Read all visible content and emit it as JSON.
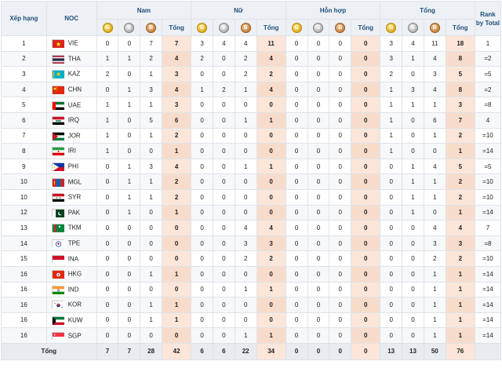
{
  "headers": {
    "xep_hang": "Xếp hạng",
    "noc": "NOC",
    "groups": [
      "Nam",
      "Nữ",
      "Hỗn hợp",
      "Tổng"
    ],
    "rank_by_total_line1": "Rank",
    "rank_by_total_line2": "by",
    "rank_by_total_line3": "Total",
    "tong": "Tổng",
    "medal_letters": {
      "gold": "G",
      "silver": "S",
      "bronze": "B"
    }
  },
  "colors": {
    "header_bg": "#edf1f5",
    "total_col_bg": "#fbe6d9",
    "header_text": "#1f4e79"
  },
  "rows": [
    {
      "rank": "1",
      "code": "VIE",
      "flag": "flag-vietnam",
      "nam": [
        "0",
        "0",
        "7",
        "7"
      ],
      "nu": [
        "3",
        "4",
        "4",
        "11"
      ],
      "hh": [
        "0",
        "0",
        "0",
        "0"
      ],
      "tong": [
        "3",
        "4",
        "11",
        "18"
      ],
      "rbt": "1"
    },
    {
      "rank": "2",
      "code": "THA",
      "flag": "flag-thailand",
      "nam": [
        "1",
        "1",
        "2",
        "4"
      ],
      "nu": [
        "2",
        "0",
        "2",
        "4"
      ],
      "hh": [
        "0",
        "0",
        "0",
        "0"
      ],
      "tong": [
        "3",
        "1",
        "4",
        "8"
      ],
      "rbt": "=2"
    },
    {
      "rank": "3",
      "code": "KAZ",
      "flag": "flag-kazakhstan",
      "nam": [
        "2",
        "0",
        "1",
        "3"
      ],
      "nu": [
        "0",
        "0",
        "2",
        "2"
      ],
      "hh": [
        "0",
        "0",
        "0",
        "0"
      ],
      "tong": [
        "2",
        "0",
        "3",
        "5"
      ],
      "rbt": "=5"
    },
    {
      "rank": "4",
      "code": "CHN",
      "flag": "flag-china",
      "nam": [
        "0",
        "1",
        "3",
        "4"
      ],
      "nu": [
        "1",
        "2",
        "1",
        "4"
      ],
      "hh": [
        "0",
        "0",
        "0",
        "0"
      ],
      "tong": [
        "1",
        "3",
        "4",
        "8"
      ],
      "rbt": "=2"
    },
    {
      "rank": "5",
      "code": "UAE",
      "flag": "flag-uae",
      "nam": [
        "1",
        "1",
        "1",
        "3"
      ],
      "nu": [
        "0",
        "0",
        "0",
        "0"
      ],
      "hh": [
        "0",
        "0",
        "0",
        "0"
      ],
      "tong": [
        "1",
        "1",
        "1",
        "3"
      ],
      "rbt": "=8"
    },
    {
      "rank": "6",
      "code": "IRQ",
      "flag": "flag-iraq",
      "nam": [
        "1",
        "0",
        "5",
        "6"
      ],
      "nu": [
        "0",
        "0",
        "1",
        "1"
      ],
      "hh": [
        "0",
        "0",
        "0",
        "0"
      ],
      "tong": [
        "1",
        "0",
        "6",
        "7"
      ],
      "rbt": "4"
    },
    {
      "rank": "7",
      "code": "JOR",
      "flag": "flag-jordan",
      "nam": [
        "1",
        "0",
        "1",
        "2"
      ],
      "nu": [
        "0",
        "0",
        "0",
        "0"
      ],
      "hh": [
        "0",
        "0",
        "0",
        "0"
      ],
      "tong": [
        "1",
        "0",
        "1",
        "2"
      ],
      "rbt": "=10"
    },
    {
      "rank": "8",
      "code": "IRI",
      "flag": "flag-iran",
      "nam": [
        "1",
        "0",
        "0",
        "1"
      ],
      "nu": [
        "0",
        "0",
        "0",
        "0"
      ],
      "hh": [
        "0",
        "0",
        "0",
        "0"
      ],
      "tong": [
        "1",
        "0",
        "0",
        "1"
      ],
      "rbt": "=14"
    },
    {
      "rank": "9",
      "code": "PHI",
      "flag": "flag-philippines",
      "nam": [
        "0",
        "1",
        "3",
        "4"
      ],
      "nu": [
        "0",
        "0",
        "1",
        "1"
      ],
      "hh": [
        "0",
        "0",
        "0",
        "0"
      ],
      "tong": [
        "0",
        "1",
        "4",
        "5"
      ],
      "rbt": "=5"
    },
    {
      "rank": "10",
      "code": "MGL",
      "flag": "flag-mongolia",
      "nam": [
        "0",
        "1",
        "1",
        "2"
      ],
      "nu": [
        "0",
        "0",
        "0",
        "0"
      ],
      "hh": [
        "0",
        "0",
        "0",
        "0"
      ],
      "tong": [
        "0",
        "1",
        "1",
        "2"
      ],
      "rbt": "=10"
    },
    {
      "rank": "10",
      "code": "SYR",
      "flag": "flag-syria",
      "nam": [
        "0",
        "1",
        "1",
        "2"
      ],
      "nu": [
        "0",
        "0",
        "0",
        "0"
      ],
      "hh": [
        "0",
        "0",
        "0",
        "0"
      ],
      "tong": [
        "0",
        "1",
        "1",
        "2"
      ],
      "rbt": "=10"
    },
    {
      "rank": "12",
      "code": "PAK",
      "flag": "flag-pakistan",
      "nam": [
        "0",
        "1",
        "0",
        "1"
      ],
      "nu": [
        "0",
        "0",
        "0",
        "0"
      ],
      "hh": [
        "0",
        "0",
        "0",
        "0"
      ],
      "tong": [
        "0",
        "1",
        "0",
        "1"
      ],
      "rbt": "=14"
    },
    {
      "rank": "13",
      "code": "TKM",
      "flag": "flag-turkmenistan",
      "nam": [
        "0",
        "0",
        "0",
        "0"
      ],
      "nu": [
        "0",
        "0",
        "4",
        "4"
      ],
      "hh": [
        "0",
        "0",
        "0",
        "0"
      ],
      "tong": [
        "0",
        "0",
        "4",
        "4"
      ],
      "rbt": "7"
    },
    {
      "rank": "14",
      "code": "TPE",
      "flag": "flag-chinese-taipei",
      "nam": [
        "0",
        "0",
        "0",
        "0"
      ],
      "nu": [
        "0",
        "0",
        "3",
        "3"
      ],
      "hh": [
        "0",
        "0",
        "0",
        "0"
      ],
      "tong": [
        "0",
        "0",
        "3",
        "3"
      ],
      "rbt": "=8"
    },
    {
      "rank": "15",
      "code": "INA",
      "flag": "flag-indonesia",
      "nam": [
        "0",
        "0",
        "0",
        "0"
      ],
      "nu": [
        "0",
        "0",
        "2",
        "2"
      ],
      "hh": [
        "0",
        "0",
        "0",
        "0"
      ],
      "tong": [
        "0",
        "0",
        "2",
        "2"
      ],
      "rbt": "=10"
    },
    {
      "rank": "16",
      "code": "HKG",
      "flag": "flag-hong-kong",
      "nam": [
        "0",
        "0",
        "1",
        "1"
      ],
      "nu": [
        "0",
        "0",
        "0",
        "0"
      ],
      "hh": [
        "0",
        "0",
        "0",
        "0"
      ],
      "tong": [
        "0",
        "0",
        "1",
        "1"
      ],
      "rbt": "=14"
    },
    {
      "rank": "16",
      "code": "IND",
      "flag": "flag-india",
      "nam": [
        "0",
        "0",
        "0",
        "0"
      ],
      "nu": [
        "0",
        "0",
        "1",
        "1"
      ],
      "hh": [
        "0",
        "0",
        "0",
        "0"
      ],
      "tong": [
        "0",
        "0",
        "1",
        "1"
      ],
      "rbt": "=14"
    },
    {
      "rank": "16",
      "code": "KOR",
      "flag": "flag-south-korea",
      "nam": [
        "0",
        "0",
        "1",
        "1"
      ],
      "nu": [
        "0",
        "0",
        "0",
        "0"
      ],
      "hh": [
        "0",
        "0",
        "0",
        "0"
      ],
      "tong": [
        "0",
        "0",
        "1",
        "1"
      ],
      "rbt": "=14"
    },
    {
      "rank": "16",
      "code": "KUW",
      "flag": "flag-kuwait",
      "nam": [
        "0",
        "0",
        "1",
        "1"
      ],
      "nu": [
        "0",
        "0",
        "0",
        "0"
      ],
      "hh": [
        "0",
        "0",
        "0",
        "0"
      ],
      "tong": [
        "0",
        "0",
        "1",
        "1"
      ],
      "rbt": "=14"
    },
    {
      "rank": "16",
      "code": "SGP",
      "flag": "flag-singapore",
      "nam": [
        "0",
        "0",
        "0",
        "0"
      ],
      "nu": [
        "0",
        "0",
        "1",
        "1"
      ],
      "hh": [
        "0",
        "0",
        "0",
        "0"
      ],
      "tong": [
        "0",
        "0",
        "1",
        "1"
      ],
      "rbt": "=14"
    }
  ],
  "totals": {
    "label": "Tổng",
    "nam": [
      "7",
      "7",
      "28",
      "42"
    ],
    "nu": [
      "6",
      "6",
      "22",
      "34"
    ],
    "hh": [
      "0",
      "0",
      "0",
      "0"
    ],
    "tong": [
      "13",
      "13",
      "50",
      "76"
    ]
  }
}
